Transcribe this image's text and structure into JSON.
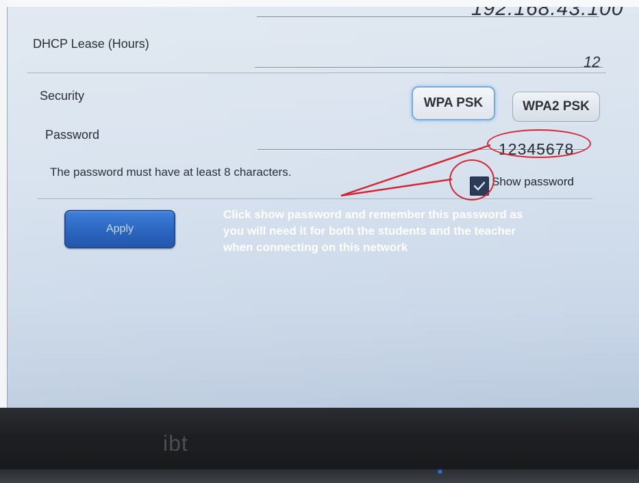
{
  "top_field": {
    "ip_partial": "192.168.43.100"
  },
  "dhcp": {
    "label": "DHCP Lease (Hours)",
    "value": "12"
  },
  "security": {
    "label": "Security",
    "options": [
      "WPA PSK",
      "WPA2 PSK"
    ],
    "selected": "WPA PSK"
  },
  "password": {
    "label": "Password",
    "value": "12345678",
    "hint": "The password must have at least 8 characters.",
    "show_password_label": "Show password",
    "show_password_checked": true
  },
  "apply_label": "Apply",
  "annotation": "Click show password and remember this password as you will need it for both the students and the teacher when connecting on this network",
  "device": {
    "brand": "ibt"
  },
  "colors": {
    "annotation_red": "#d42532",
    "apply_blue": "#2a63be"
  }
}
